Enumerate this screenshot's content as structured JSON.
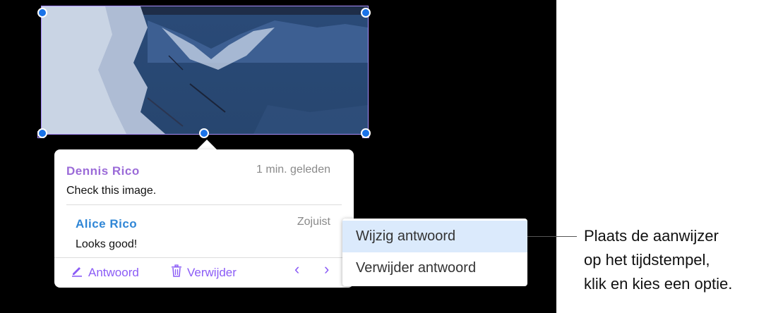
{
  "comments": [
    {
      "author": "Dennis Rico",
      "timestamp": "1 min. geleden",
      "text": "Check this image.",
      "author_color": "#9b6bd8"
    },
    {
      "author": "Alice Rico",
      "timestamp": "Zojuist",
      "text": "Looks good!",
      "author_color": "#2f86d6"
    }
  ],
  "toolbar": {
    "reply_label": "Antwoord",
    "delete_label": "Verwijder",
    "prev_arrow": "‹",
    "next_arrow": "›"
  },
  "context_menu": {
    "items": [
      "Wijzig antwoord",
      "Verwijder antwoord"
    ],
    "selected_index": 0
  },
  "callout": {
    "lines": [
      "Plaats de aanwijzer",
      "op het tijdstempel,",
      "klik en kies een optie."
    ]
  },
  "colors": {
    "accent": "#8b5cf6",
    "handle": "#1a73e8",
    "selection": "#dbeafc"
  },
  "icons": {
    "reply": "pencil-icon",
    "delete": "trash-icon",
    "prev": "chevron-left-icon",
    "next": "chevron-right-icon"
  }
}
